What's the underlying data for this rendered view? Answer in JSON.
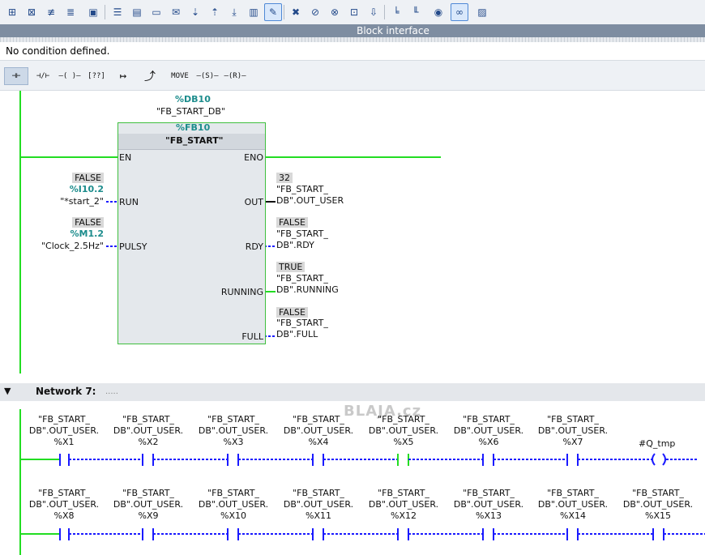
{
  "toolbar": {
    "icons": [
      "insert-network-icon",
      "delete-network-icon",
      "insert-branch-icon",
      "close-branch-icon",
      "print-icon",
      "display-favorites-icon",
      "absolute-operands-icon",
      "show-comments-icon",
      "comment-icon",
      "download-icon",
      "upload-icon",
      "network-titles-icon",
      "monitoring-icon",
      "breakpoint-icon",
      "go-to-icon",
      "call-hierarchy-icon",
      "assignments-icon",
      "move-icon",
      "modify-icon",
      "open-block-icon",
      "monitor-on-off-icon",
      "block-view-icon"
    ]
  },
  "block_interface": {
    "label": "Block interface"
  },
  "condition": {
    "text": "No condition defined."
  },
  "instructions": {
    "items": [
      "no-contact",
      "nc-contact",
      "coil",
      "empty-box",
      "open-branch",
      "close-branch",
      "MOVE",
      "-(S)-",
      "-(R)-"
    ],
    "move_label": "MOVE",
    "set_label": "S",
    "reset_label": "R"
  },
  "network6": {
    "instance_db": {
      "address": "%DB10",
      "name": "\"FB_START_DB\""
    },
    "fb": {
      "address": "%FB10",
      "name": "\"FB_START\""
    },
    "inputs": [
      {
        "pin": "EN"
      },
      {
        "pin": "RUN",
        "state": "FALSE",
        "address": "%I10.2",
        "tag": "\"*start_2\""
      },
      {
        "pin": "PULSY",
        "state": "FALSE",
        "address": "%M1.2",
        "tag": "\"Clock_2.5Hz\""
      }
    ],
    "outputs": [
      {
        "pin": "ENO"
      },
      {
        "pin": "OUT",
        "value": "32",
        "tag_line1": "\"FB_START_",
        "tag_line2": "DB\".OUT_USER"
      },
      {
        "pin": "RDY",
        "value": "FALSE",
        "tag_line1": "\"FB_START_",
        "tag_line2": "DB\".RDY"
      },
      {
        "pin": "RUNNING",
        "value": "TRUE",
        "tag_line1": "\"FB_START_",
        "tag_line2": "DB\".RUNNING"
      },
      {
        "pin": "FULL",
        "value": "FALSE",
        "tag_line1": "\"FB_START_",
        "tag_line2": "DB\".FULL"
      }
    ]
  },
  "network7": {
    "title": "Network 7:",
    "comment": ".....",
    "watermark": "BLAJA.cz",
    "row1": [
      {
        "l1": "\"FB_START_",
        "l2": "DB\".OUT_USER.",
        "l3": "%X1",
        "state": "false"
      },
      {
        "l1": "\"FB_START_",
        "l2": "DB\".OUT_USER.",
        "l3": "%X2",
        "state": "false"
      },
      {
        "l1": "\"FB_START_",
        "l2": "DB\".OUT_USER.",
        "l3": "%X3",
        "state": "false"
      },
      {
        "l1": "\"FB_START_",
        "l2": "DB\".OUT_USER.",
        "l3": "%X4",
        "state": "false"
      },
      {
        "l1": "\"FB_START_",
        "l2": "DB\".OUT_USER.",
        "l3": "%X5",
        "state": "true"
      },
      {
        "l1": "\"FB_START_",
        "l2": "DB\".OUT_USER.",
        "l3": "%X6",
        "state": "false"
      },
      {
        "l1": "\"FB_START_",
        "l2": "DB\".OUT_USER.",
        "l3": "%X7",
        "state": "false"
      }
    ],
    "coil": {
      "tag": "#Q_tmp"
    },
    "row2": [
      {
        "l1": "\"FB_START_",
        "l2": "DB\".OUT_USER.",
        "l3": "%X8"
      },
      {
        "l1": "\"FB_START_",
        "l2": "DB\".OUT_USER.",
        "l3": "%X9"
      },
      {
        "l1": "\"FB_START_",
        "l2": "DB\".OUT_USER.",
        "l3": "%X10"
      },
      {
        "l1": "\"FB_START_",
        "l2": "DB\".OUT_USER.",
        "l3": "%X11"
      },
      {
        "l1": "\"FB_START_",
        "l2": "DB\".OUT_USER.",
        "l3": "%X12"
      },
      {
        "l1": "\"FB_START_",
        "l2": "DB\".OUT_USER.",
        "l3": "%X13"
      },
      {
        "l1": "\"FB_START_",
        "l2": "DB\".OUT_USER.",
        "l3": "%X14"
      },
      {
        "l1": "\"FB_START_",
        "l2": "DB\".OUT_USER.",
        "l3": "%X15"
      }
    ]
  },
  "colors": {
    "energized": "#22dd22",
    "unpowered": "#1a1aff",
    "teal": "#1c8c8c"
  }
}
